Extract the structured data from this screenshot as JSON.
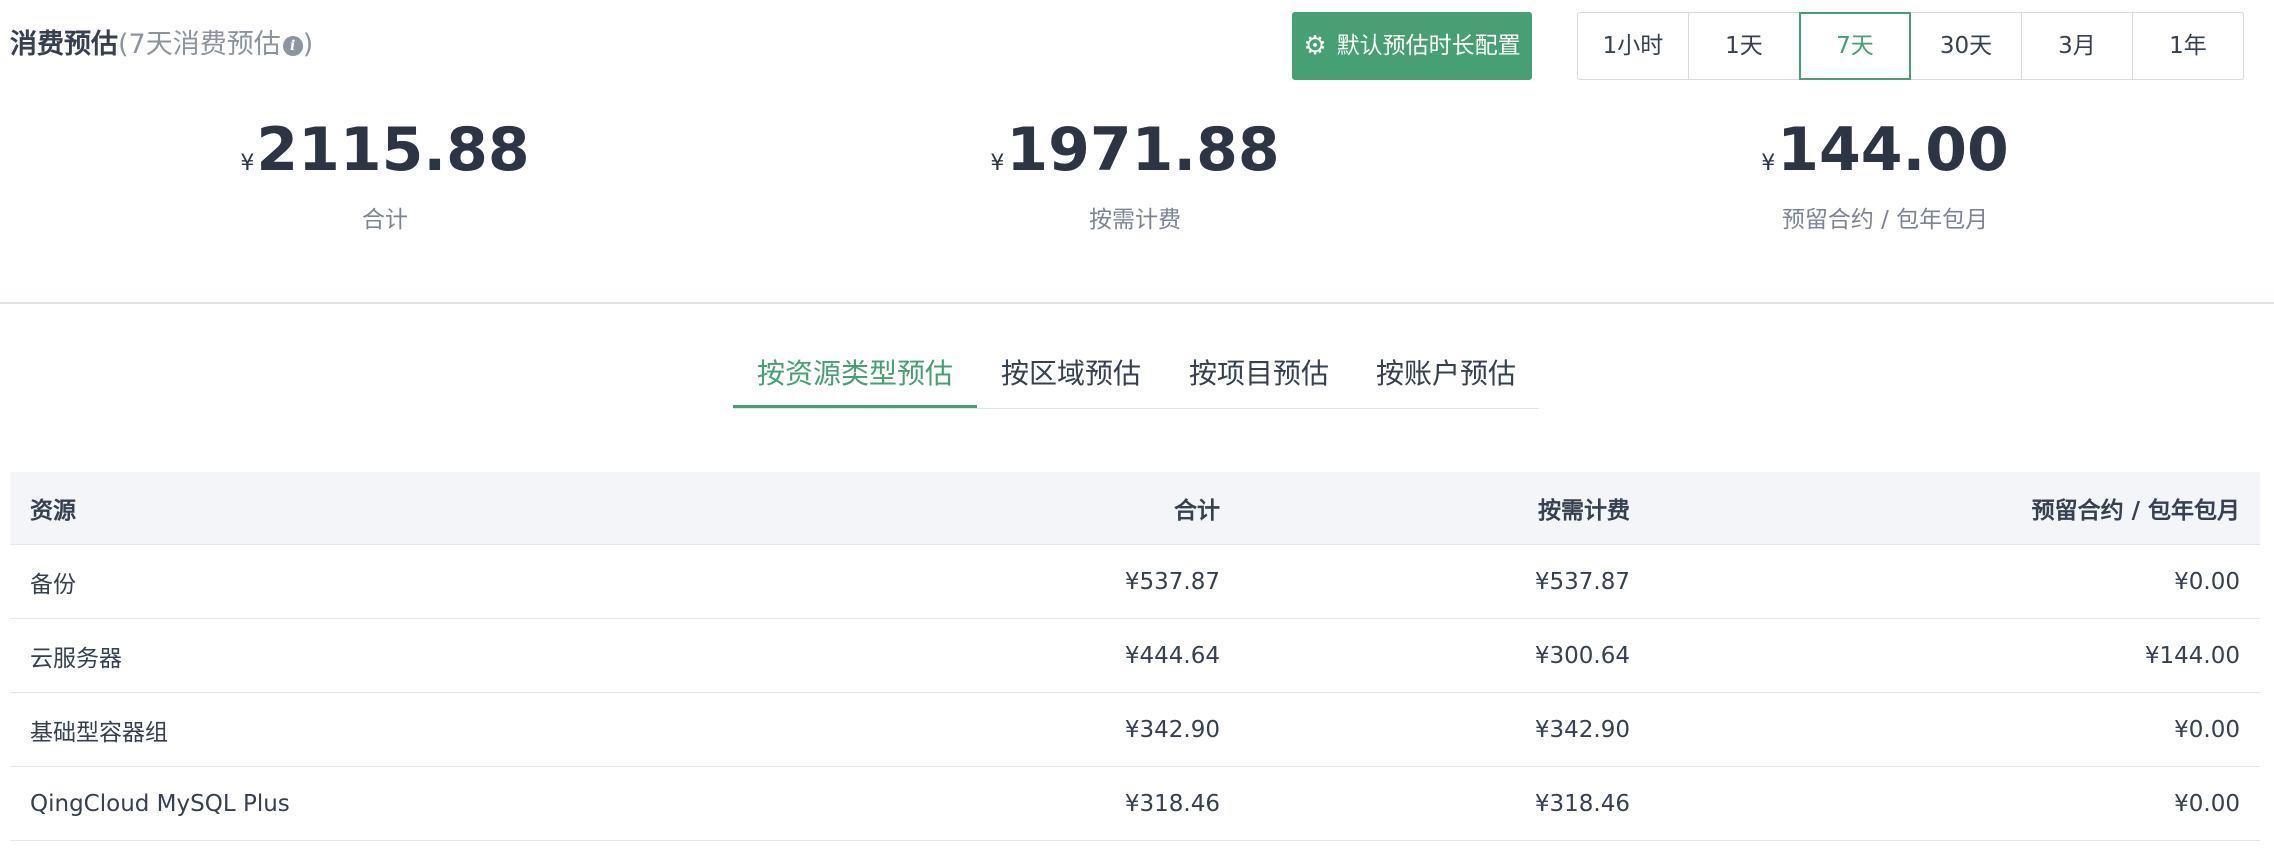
{
  "header": {
    "title": "消费预估",
    "subtitle_open": "(7天消费预估",
    "info_icon_glyph": "i",
    "subtitle_close": ")",
    "config_button_icon": "gear-icon",
    "config_button_label": "默认预估时长配置",
    "ranges": [
      "1小时",
      "1天",
      "7天",
      "30天",
      "3月",
      "1年"
    ],
    "active_range": "7天"
  },
  "summary": {
    "currency": "¥",
    "total": {
      "amount": "2115.88",
      "label": "合计"
    },
    "on_demand": {
      "amount": "1971.88",
      "label": "按需计费"
    },
    "reserved": {
      "amount": "144.00",
      "label": "预留合约 / 包年包月"
    }
  },
  "tabs": [
    "按资源类型预估",
    "按区域预估",
    "按项目预估",
    "按账户预估"
  ],
  "active_tab": "按资源类型预估",
  "table": {
    "headers": [
      "资源",
      "合计",
      "按需计费",
      "预留合约 / 包年包月"
    ],
    "rows": [
      [
        "备份",
        "¥537.87",
        "¥537.87",
        "¥0.00"
      ],
      [
        "云服务器",
        "¥444.64",
        "¥300.64",
        "¥144.00"
      ],
      [
        "基础型容器组",
        "¥342.90",
        "¥342.90",
        "¥0.00"
      ],
      [
        "QingCloud MySQL Plus",
        "¥318.46",
        "¥318.46",
        "¥0.00"
      ]
    ]
  },
  "colors": {
    "accent": "#47a074",
    "text": "#36404f",
    "muted": "#8c93a1",
    "header_bg": "#f4f5f8"
  }
}
